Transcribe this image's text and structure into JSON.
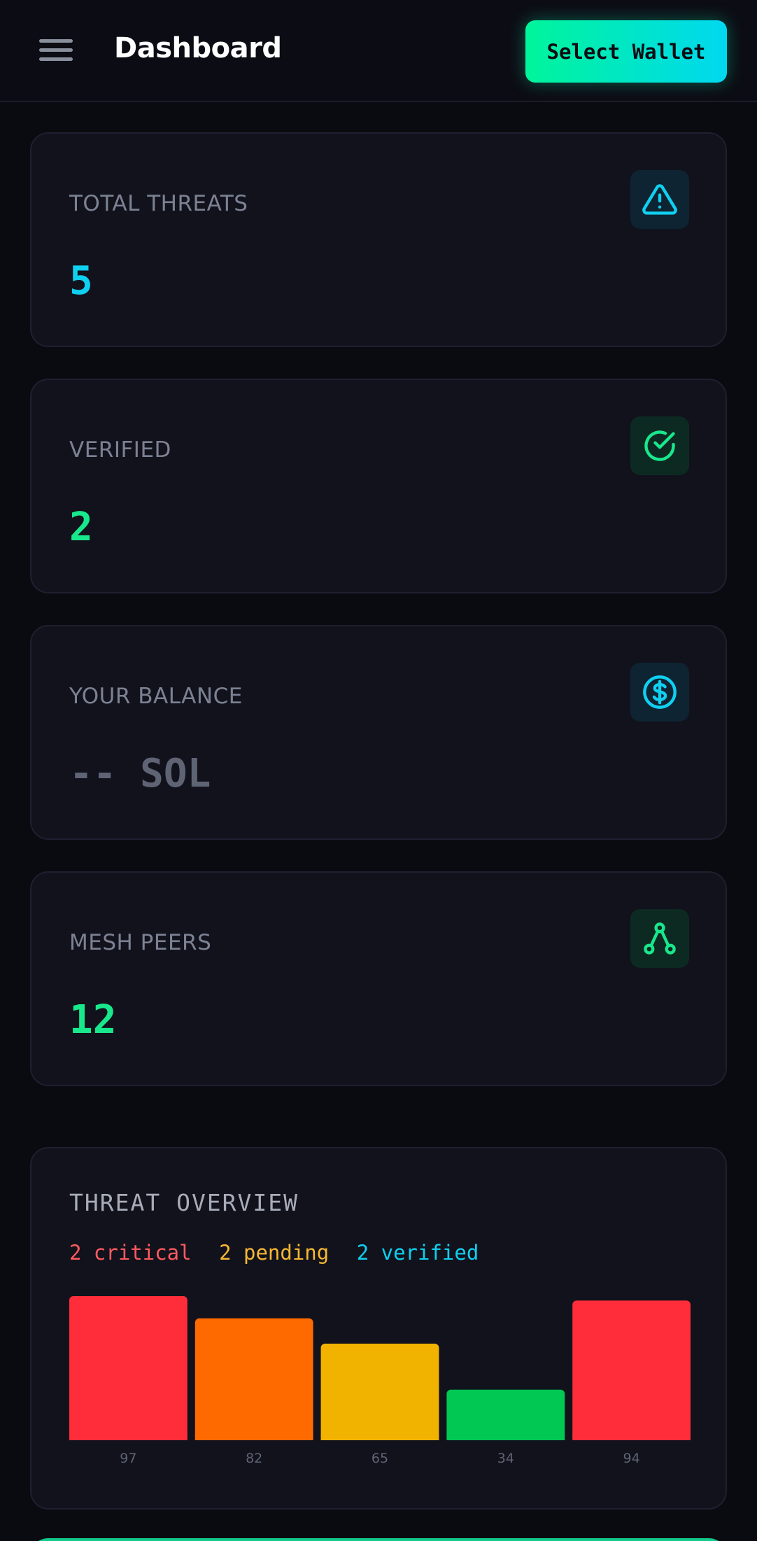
{
  "header": {
    "title": "Dashboard",
    "wallet_button": "Select Wallet"
  },
  "stats": [
    {
      "label": "TOTAL THREATS",
      "value": "5",
      "icon": "alert-triangle-icon",
      "color": "#10d0f0"
    },
    {
      "label": "VERIFIED",
      "value": "2",
      "icon": "check-circle-icon",
      "color": "#18e88c"
    },
    {
      "label": "YOUR BALANCE",
      "value": "-- SOL",
      "icon": "dollar-circle-icon",
      "color": "#5f6475"
    },
    {
      "label": "MESH PEERS",
      "value": "12",
      "icon": "network-icon",
      "color": "#18e88c"
    }
  ],
  "overview": {
    "title": "THREAT OVERVIEW",
    "legend": {
      "critical": "2 critical",
      "pending": "2 pending",
      "verified": "2 verified"
    },
    "colors": {
      "critical": "#ff5a5f",
      "pending": "#f7b733",
      "verified": "#10d0f0"
    }
  },
  "chart_data": {
    "type": "bar",
    "categories": [
      "97",
      "82",
      "65",
      "34",
      "94"
    ],
    "values": [
      97,
      82,
      65,
      34,
      94
    ],
    "ylim": [
      0,
      97
    ],
    "colors": [
      "#ff2d3a",
      "#ff6a00",
      "#f2b300",
      "#00c853",
      "#ff2d3a"
    ],
    "grid": false,
    "title": "",
    "xlabel": "",
    "ylabel": ""
  }
}
